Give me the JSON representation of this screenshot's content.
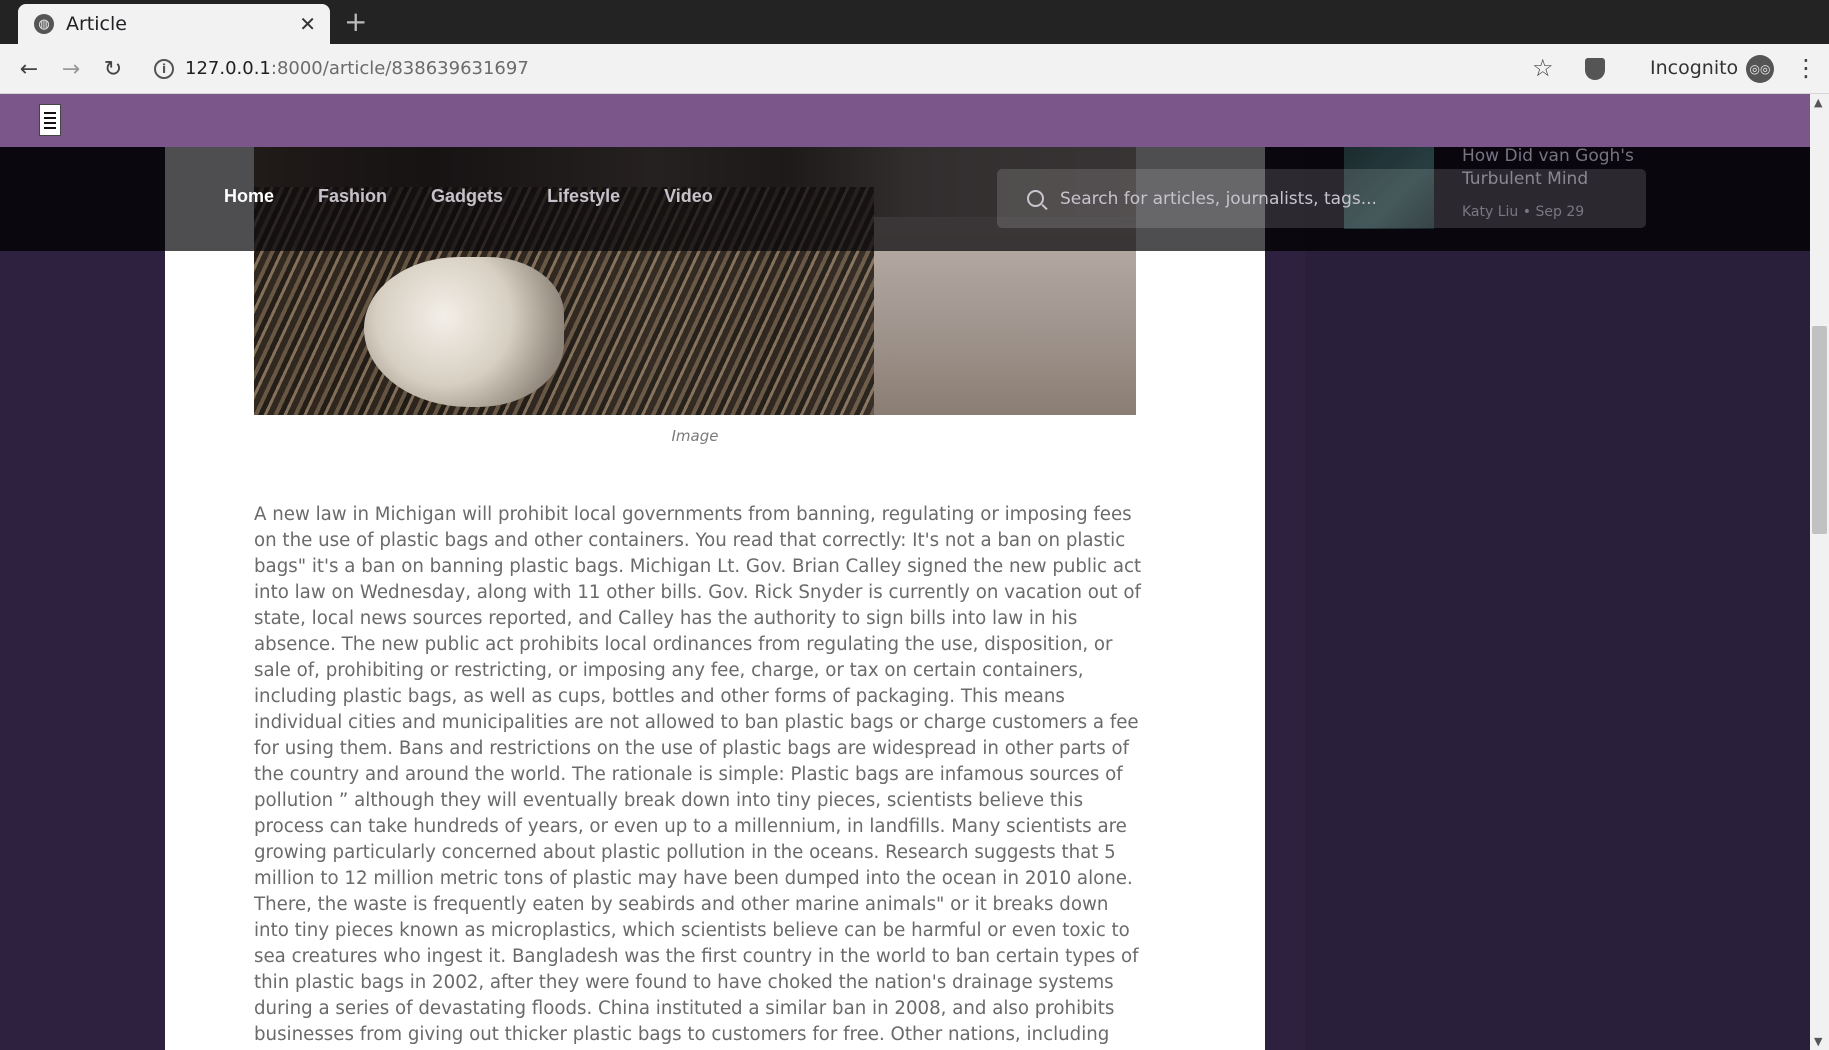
{
  "browser": {
    "tab_title": "Article",
    "new_tab_symbol": "+",
    "close_symbol": "✕",
    "url_host": "127.0.0.1",
    "url_rest": ":8000/article/838639631697",
    "incognito_label": "Incognito"
  },
  "nav": {
    "items": [
      "Home",
      "Fashion",
      "Gadgets",
      "Lifestyle",
      "Video"
    ],
    "active": "Home",
    "search_placeholder": "Search for articles, journalists, tags..."
  },
  "sidebar": {
    "card_title": "How Did van Gogh's Turbulent Mind",
    "card_author": "Katy Liu",
    "card_date": "Sep 29",
    "meta_sep": "•"
  },
  "article": {
    "image_caption": "Image",
    "body": "A new law in Michigan will prohibit local governments from banning, regulating or imposing fees on the use of plastic bags and other containers. You read that correctly: It's not a ban on plastic bags\" it's a ban on banning plastic bags. Michigan Lt. Gov. Brian Calley signed the new public act into law on Wednesday, along with 11 other bills. Gov. Rick Snyder is currently on vacation out of state, local news sources reported, and Calley has the authority to sign bills into law in his absence. The new public act prohibits local ordinances from regulating the use, disposition, or sale of, prohibiting or restricting, or imposing any fee, charge, or tax on certain containers, including plastic bags, as well as cups, bottles and other forms of packaging. This means individual cities and municipalities are not allowed to ban plastic bags or charge customers a fee for using them. Bans and restrictions on the use of plastic bags are widespread in other parts of the country and around the world. The rationale is simple: Plastic bags are infamous sources of pollution ” although they will eventually break down into tiny pieces, scientists believe this process can take hundreds of years, or even up to a millennium, in landfills. Many scientists are growing particularly concerned about plastic pollution in the oceans. Research suggests that 5 million to 12 million metric tons of plastic may have been dumped into the ocean in 2010 alone. There, the waste is frequently eaten by seabirds and other marine animals\" or it breaks down into tiny pieces known as microplastics, which scientists believe can be harmful or even toxic to sea creatures who ingest it. Bangladesh was the first country in the world to ban certain types of thin plastic bags in 2002, after they were found to have choked the nation's drainage systems during a series of devastating floods. China instituted a similar ban in 2008, and also prohibits businesses from giving out thicker plastic bags to customers for free. Other nations, including South Africa"
  },
  "colors": {
    "header_purple": "#7b568b",
    "page_background": "#2d213f",
    "body_text": "#6a6a6a"
  }
}
